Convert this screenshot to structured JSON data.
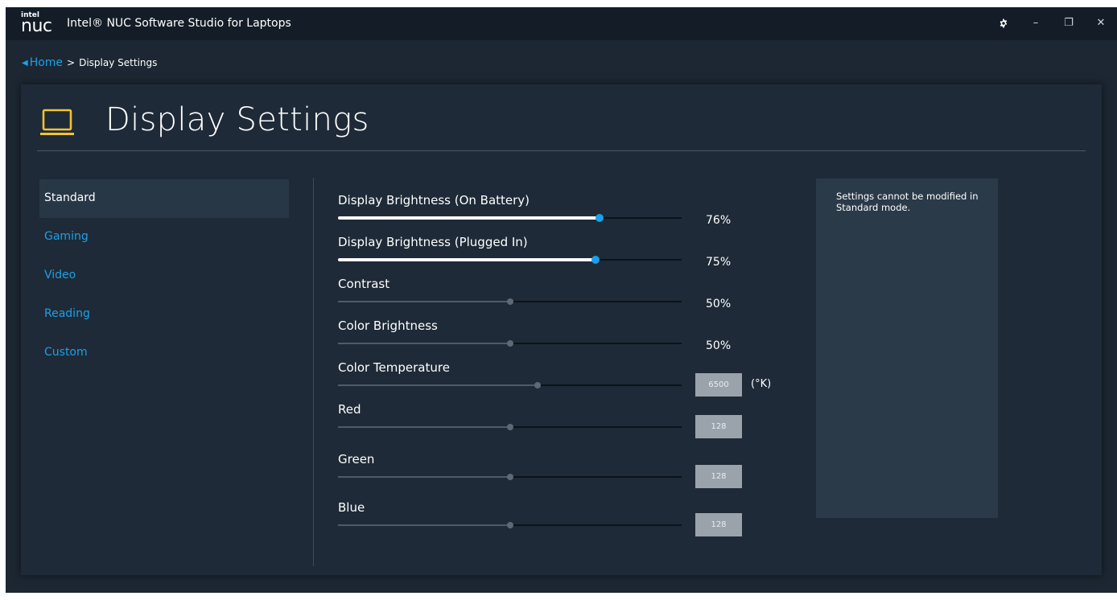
{
  "window": {
    "logo_top": "intel",
    "logo_bottom": "nuc",
    "title": "Intel® NUC Software Studio for Laptops",
    "controls": {
      "settings_icon": "gear-icon",
      "minimize": "–",
      "restore": "❐",
      "close": "✕"
    }
  },
  "breadcrumb": {
    "home": "Home",
    "separator": ">",
    "current": "Display Settings"
  },
  "page": {
    "title": "Display Settings",
    "icon": "laptop-icon",
    "icon_color": "#f2c230"
  },
  "modes": [
    {
      "label": "Standard",
      "active": true
    },
    {
      "label": "Gaming",
      "active": false
    },
    {
      "label": "Video",
      "active": false
    },
    {
      "label": "Reading",
      "active": false
    },
    {
      "label": "Custom",
      "active": false
    }
  ],
  "settings": [
    {
      "label": "Display Brightness (On Battery)",
      "fraction": 0.76,
      "value_text": "76%",
      "enabled": true
    },
    {
      "label": "Display Brightness (Plugged In)",
      "fraction": 0.75,
      "value_text": "75%",
      "enabled": true
    },
    {
      "label": "Contrast",
      "fraction": 0.5,
      "value_text": "50%",
      "enabled": false
    },
    {
      "label": "Color Brightness",
      "fraction": 0.5,
      "value_text": "50%",
      "enabled": false
    },
    {
      "label": "Color Temperature",
      "fraction": 0.58,
      "box_value": "6500",
      "unit": "(°K)",
      "enabled": false
    },
    {
      "label": "Red",
      "fraction": 0.5,
      "box_value": "128",
      "enabled": false
    },
    {
      "label": "Green",
      "fraction": 0.5,
      "box_value": "128",
      "enabled": false
    },
    {
      "label": "Blue",
      "fraction": 0.5,
      "box_value": "128",
      "enabled": false
    }
  ],
  "info": {
    "text": "Settings cannot be modified in Standard mode."
  },
  "colors": {
    "accent": "#1f9fe8",
    "slider_active": "#1aa0ea",
    "background": "#1c2733"
  }
}
